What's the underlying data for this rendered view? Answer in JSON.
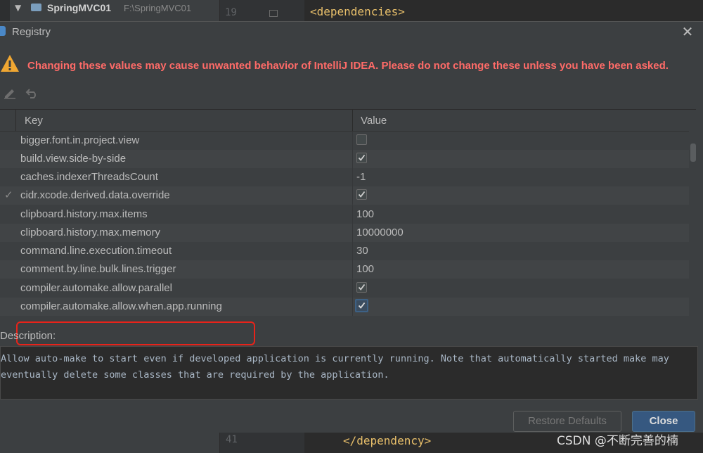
{
  "ide": {
    "project_name": "SpringMVC01",
    "project_path": "F:\\SpringMVC01",
    "top_line_number": "19",
    "top_code": "<dependencies>",
    "bottom_line_number": "41",
    "bottom_code": "</dependency>"
  },
  "dialog": {
    "title": "Registry",
    "warning": "Changing these values may cause unwanted behavior of IntelliJ IDEA. Please do not change these unless you have been asked.",
    "table": {
      "headers": {
        "key": "Key",
        "value": "Value"
      },
      "rows": [
        {
          "key": "bigger.font.in.project.view",
          "type": "checkbox",
          "checked": false
        },
        {
          "key": "build.view.side-by-side",
          "type": "checkbox",
          "checked": true
        },
        {
          "key": "caches.indexerThreadsCount",
          "type": "text",
          "value": "-1"
        },
        {
          "key": "cidr.xcode.derived.data.override",
          "type": "checkbox",
          "checked": true,
          "modified_mark": "✓"
        },
        {
          "key": "clipboard.history.max.items",
          "type": "text",
          "value": "100"
        },
        {
          "key": "clipboard.history.max.memory",
          "type": "text",
          "value": "10000000"
        },
        {
          "key": "command.line.execution.timeout",
          "type": "text",
          "value": "30"
        },
        {
          "key": "comment.by.line.bulk.lines.trigger",
          "type": "text",
          "value": "100"
        },
        {
          "key": "compiler.automake.allow.parallel",
          "type": "checkbox",
          "checked": true
        },
        {
          "key": "compiler.automake.allow.when.app.running",
          "type": "checkbox",
          "checked": true,
          "selected": true
        }
      ]
    },
    "description_label": "Description:",
    "description": "Allow auto-make to start even if developed application is currently running. Note that automatically started make may\neventually delete some classes that are required by the application.",
    "buttons": {
      "restore": "Restore Defaults",
      "close": "Close"
    }
  },
  "colors": {
    "warning": "#ff6b68",
    "highlight": "#e8231a",
    "primary_button": "#365880"
  },
  "watermark": "CSDN @不断完善的楠"
}
